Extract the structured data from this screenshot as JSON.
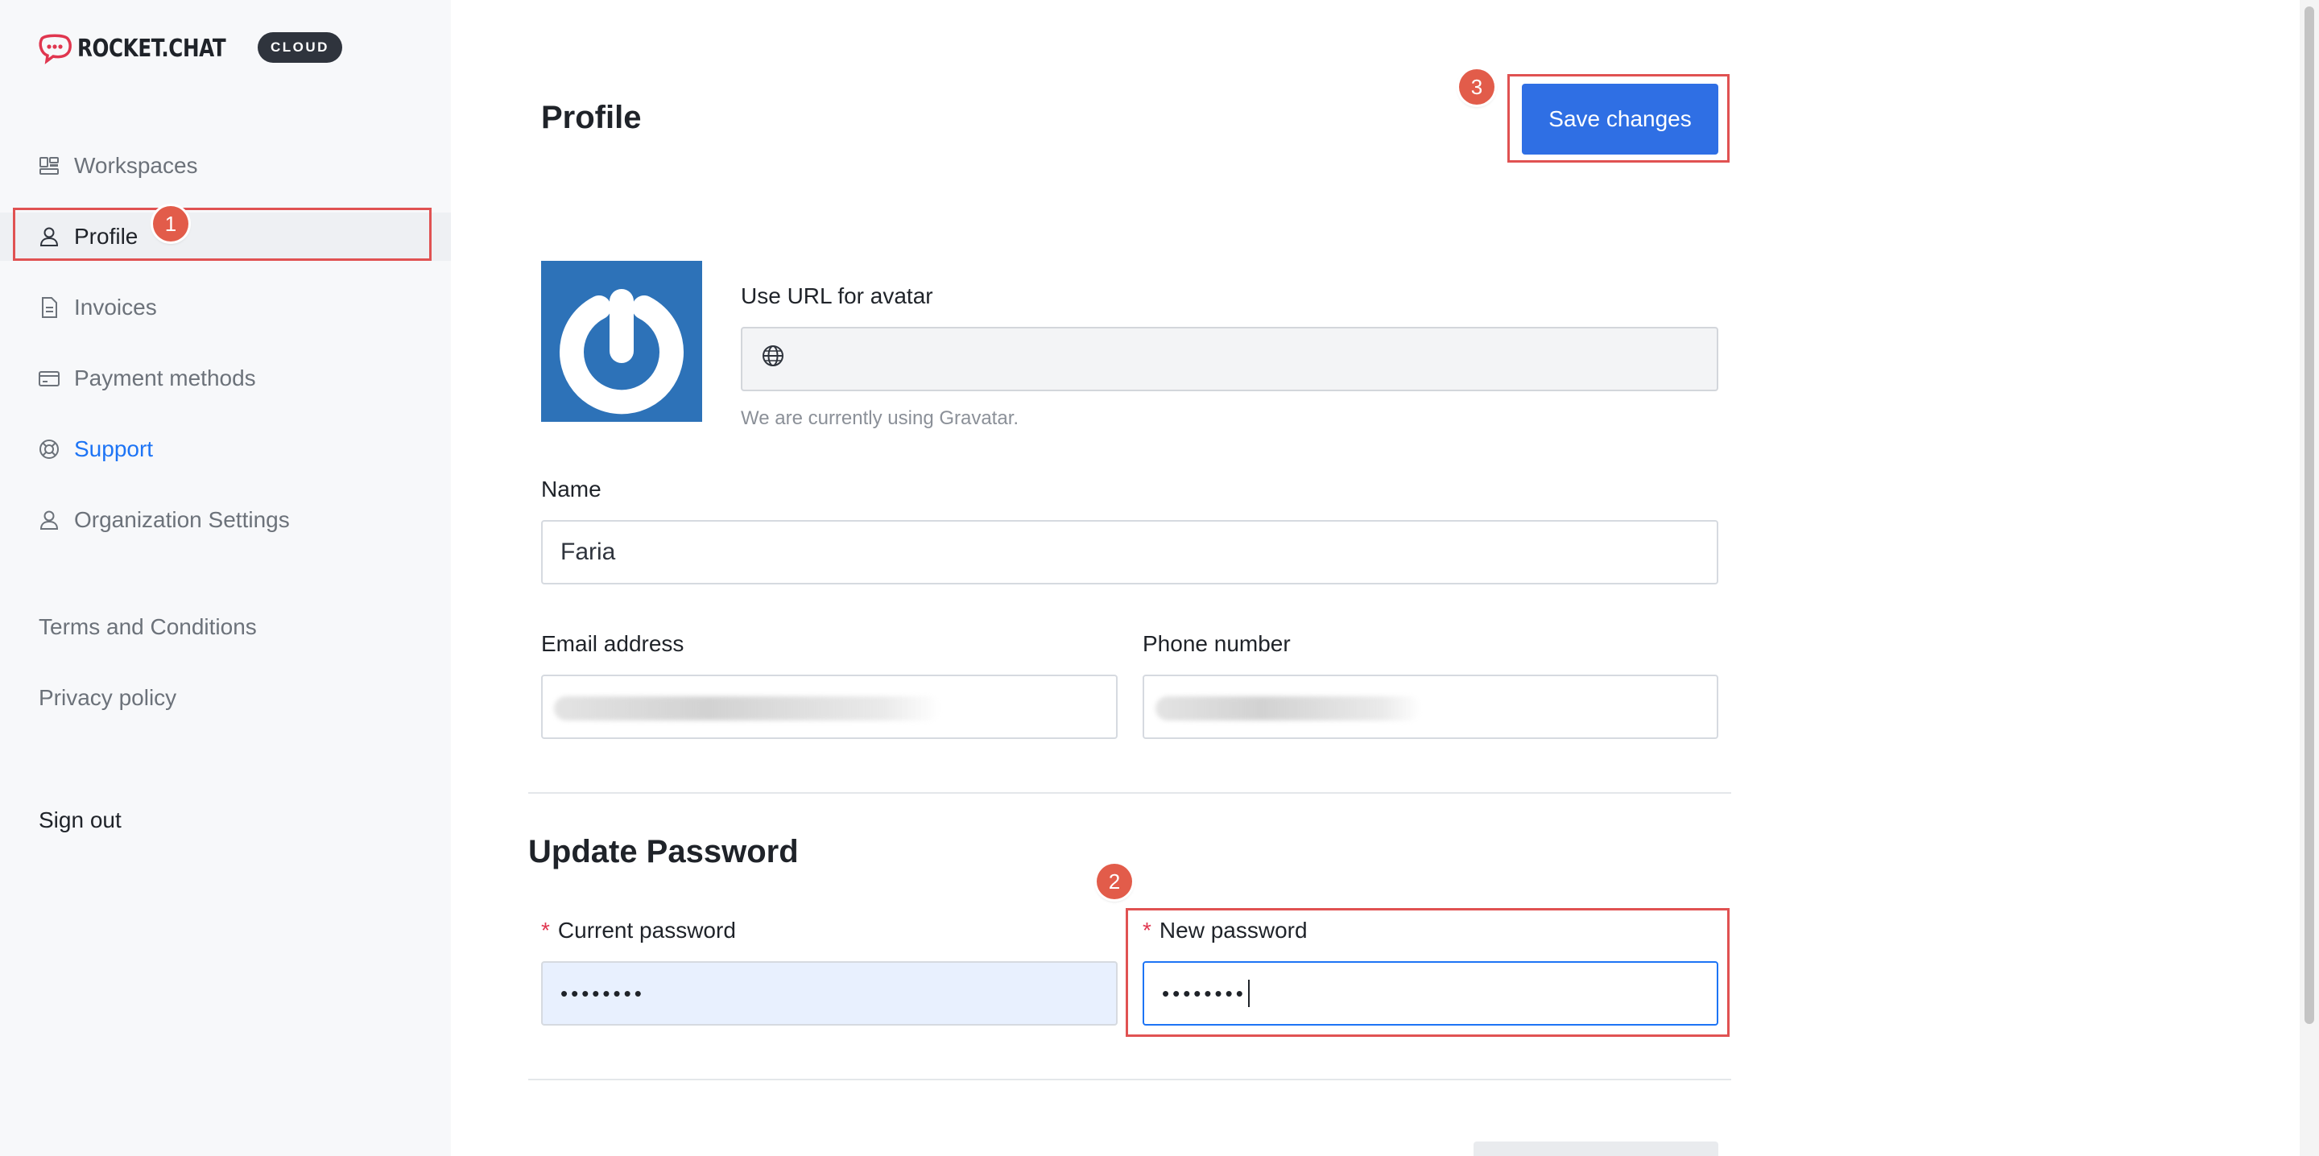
{
  "brand": {
    "name": "ROCKET.CHAT",
    "badge": "CLOUD"
  },
  "sidebar": {
    "items": [
      {
        "label": "Workspaces",
        "icon": "workspaces-icon"
      },
      {
        "label": "Profile",
        "icon": "user-icon"
      },
      {
        "label": "Invoices",
        "icon": "document-icon"
      },
      {
        "label": "Payment methods",
        "icon": "credit-card-icon"
      },
      {
        "label": "Support",
        "icon": "lifebuoy-icon"
      },
      {
        "label": "Organization Settings",
        "icon": "user-icon"
      }
    ],
    "links": [
      "Terms and Conditions",
      "Privacy policy"
    ],
    "sign_out": "Sign out"
  },
  "annotations": [
    "1",
    "2",
    "3"
  ],
  "main": {
    "title": "Profile",
    "save_label": "Save changes",
    "avatar_label": "Use URL for avatar",
    "avatar_hint": "We are currently using Gravatar.",
    "name_label": "Name",
    "name_value": "Faria",
    "email_label": "Email address",
    "phone_label": "Phone number",
    "update_password_title": "Update Password",
    "current_password_label": "Current password",
    "current_password_value": "••••••••",
    "new_password_label": "New password",
    "new_password_value": "••••••••",
    "required_mark": "*"
  },
  "colors": {
    "accent": "#2f6fe4",
    "link": "#1d74f5",
    "annotation": "#e05252",
    "avatar_bg": "#2d72b8"
  }
}
